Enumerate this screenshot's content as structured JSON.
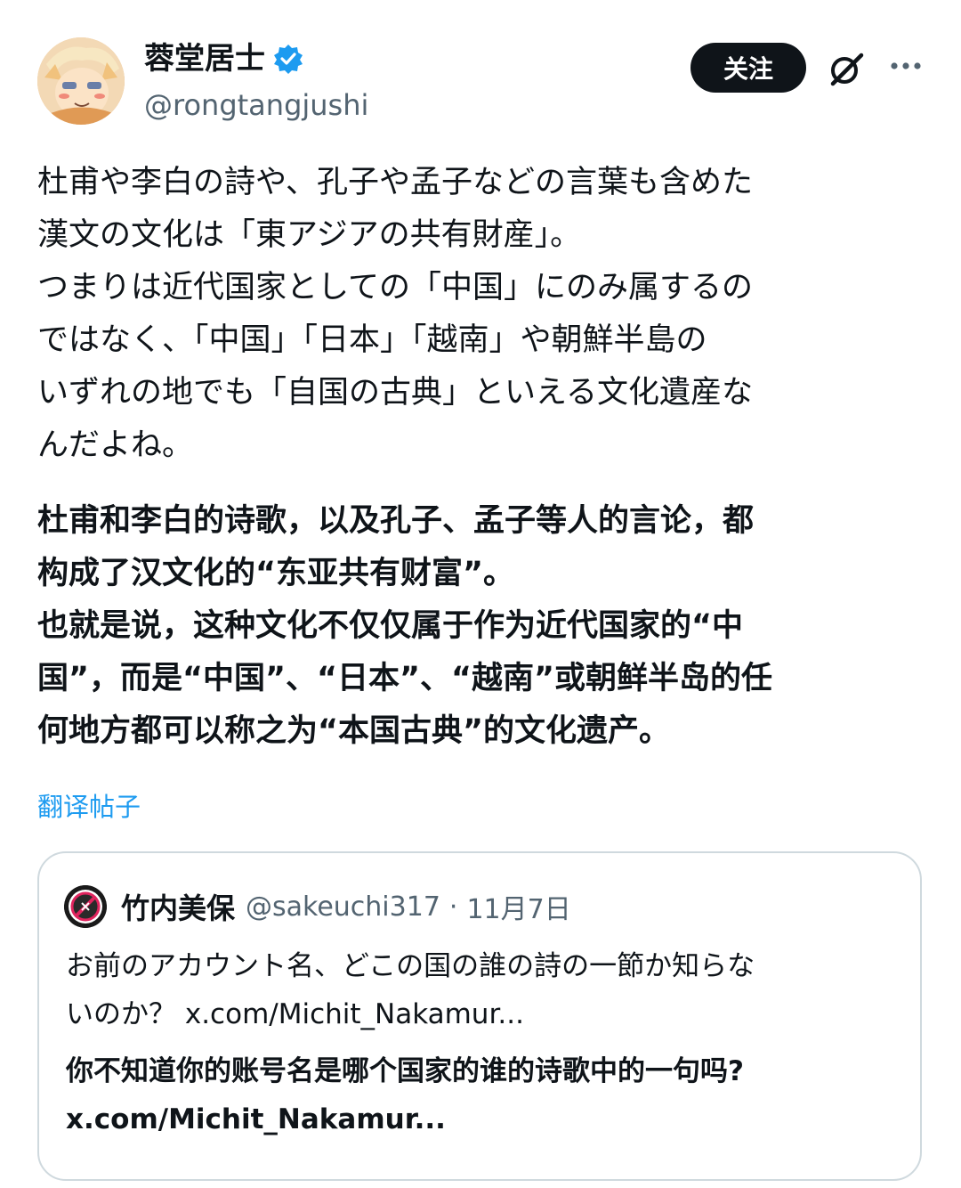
{
  "author": {
    "display_name": "蓉堂居士",
    "handle": "@rongtangjushi",
    "avatar_icon": "avatar-anime-character",
    "verified_icon": "verified-badge-icon",
    "verified_color": "#1d9bf0"
  },
  "actions": {
    "follow_label": "关注",
    "grok_icon": "grok-icon",
    "more_icon": "more-icon"
  },
  "post": {
    "text": "杜甫や李白の詩や、孔子や孟子などの言葉も含めた\n漢文の文化は「東アジアの共有財産」。\nつまりは近代国家としての「中国」にのみ属するの\nではなく、「中国」「日本」「越南」や朝鮮半島の\nいずれの地でも「自国の古典」といえる文化遺産な\nんだよね。",
    "translation": "杜甫和李白的诗歌，以及孔子、孟子等人的言论，都\n构成了汉文化的“东亚共有财富”。\n也就是说，这种文化不仅仅属于作为近代国家的“中\n国”，而是“中国”、“日本”、“越南”或朝鲜半岛的任\n何地方都可以称之为“本国古典”的文化遗产。",
    "translate_link": "翻译帖子"
  },
  "quote": {
    "display_name": "竹内美保",
    "handle": "@sakeuchi317",
    "separator": "·",
    "date": "11月7日",
    "text": "お前のアカウント名、どこの国の誰の詩の一節か知らな\nいのか？ x.com/Michit_Nakamur...",
    "translation": "你不知道你的账号名是哪个国家的谁的诗歌中的一句吗?\nx.com/Michit_Nakamur..."
  },
  "colors": {
    "text_primary": "#0f1419",
    "text_secondary": "#536471",
    "link": "#1d9bf0",
    "border": "#cfd9de",
    "button_bg": "#0f1419"
  }
}
